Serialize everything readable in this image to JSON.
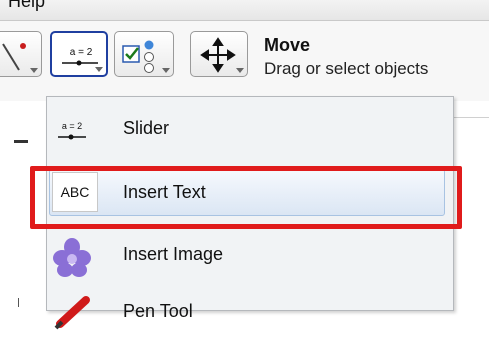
{
  "menubar": {
    "help_label": "Help"
  },
  "toolbar": {
    "slider_tool_text": "a = 2",
    "move_title": "Move",
    "move_description": "Drag or select objects"
  },
  "dropdown": {
    "items": [
      {
        "label": "Slider",
        "icon": "slider-icon",
        "icon_text": "a = 2"
      },
      {
        "label": "Insert Text",
        "icon": "text-icon",
        "icon_text": "ABC"
      },
      {
        "label": "Insert Image",
        "icon": "image-icon"
      },
      {
        "label": "Pen Tool",
        "icon": "pen-icon"
      }
    ]
  },
  "colors": {
    "highlight_border": "#e01b1b",
    "selected_tool_border": "#1f3fa0",
    "menu_background": "#f1f3f5"
  }
}
